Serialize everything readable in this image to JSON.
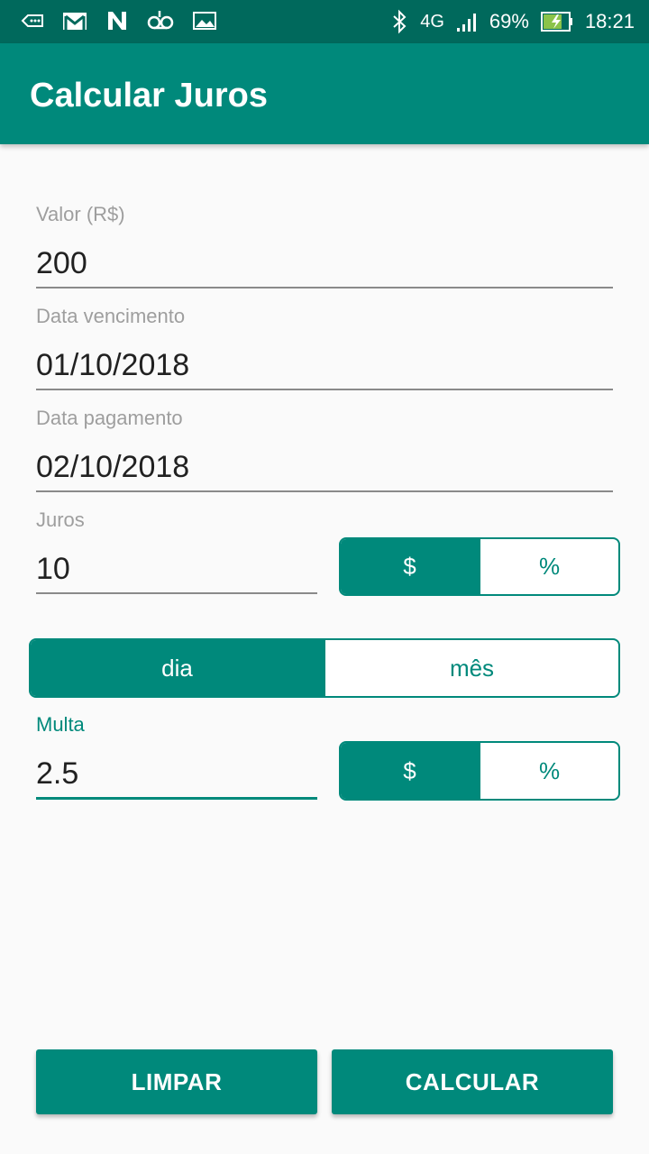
{
  "status_bar": {
    "network": "4G",
    "battery": "69%",
    "time": "18:21",
    "left_icons": [
      "voicemail-icon",
      "gmail-icon",
      "n-app-icon",
      "voicemail-tape-icon",
      "image-icon"
    ],
    "right_icons": [
      "bluetooth-icon",
      "signal-icon",
      "battery-charging-icon"
    ]
  },
  "app_bar": {
    "title": "Calcular Juros"
  },
  "form": {
    "valor": {
      "label": "Valor (R$)",
      "value": "200"
    },
    "vencimento": {
      "label": "Data vencimento",
      "value": "01/10/2018"
    },
    "pagamento": {
      "label": "Data pagamento",
      "value": "02/10/2018"
    },
    "juros": {
      "label": "Juros",
      "value": "10"
    },
    "juros_toggle": {
      "options": [
        "$",
        "%"
      ],
      "selected": "$"
    },
    "period_toggle": {
      "options": [
        "dia",
        "mês"
      ],
      "selected": "dia"
    },
    "multa": {
      "label": "Multa",
      "value": "2.5"
    },
    "multa_toggle": {
      "options": [
        "$",
        "%"
      ],
      "selected": "$"
    }
  },
  "buttons": {
    "clear": "LIMPAR",
    "calculate": "CALCULAR"
  },
  "colors": {
    "primary": "#00897b",
    "primary_dark": "#00695c",
    "background": "#fafafa"
  }
}
